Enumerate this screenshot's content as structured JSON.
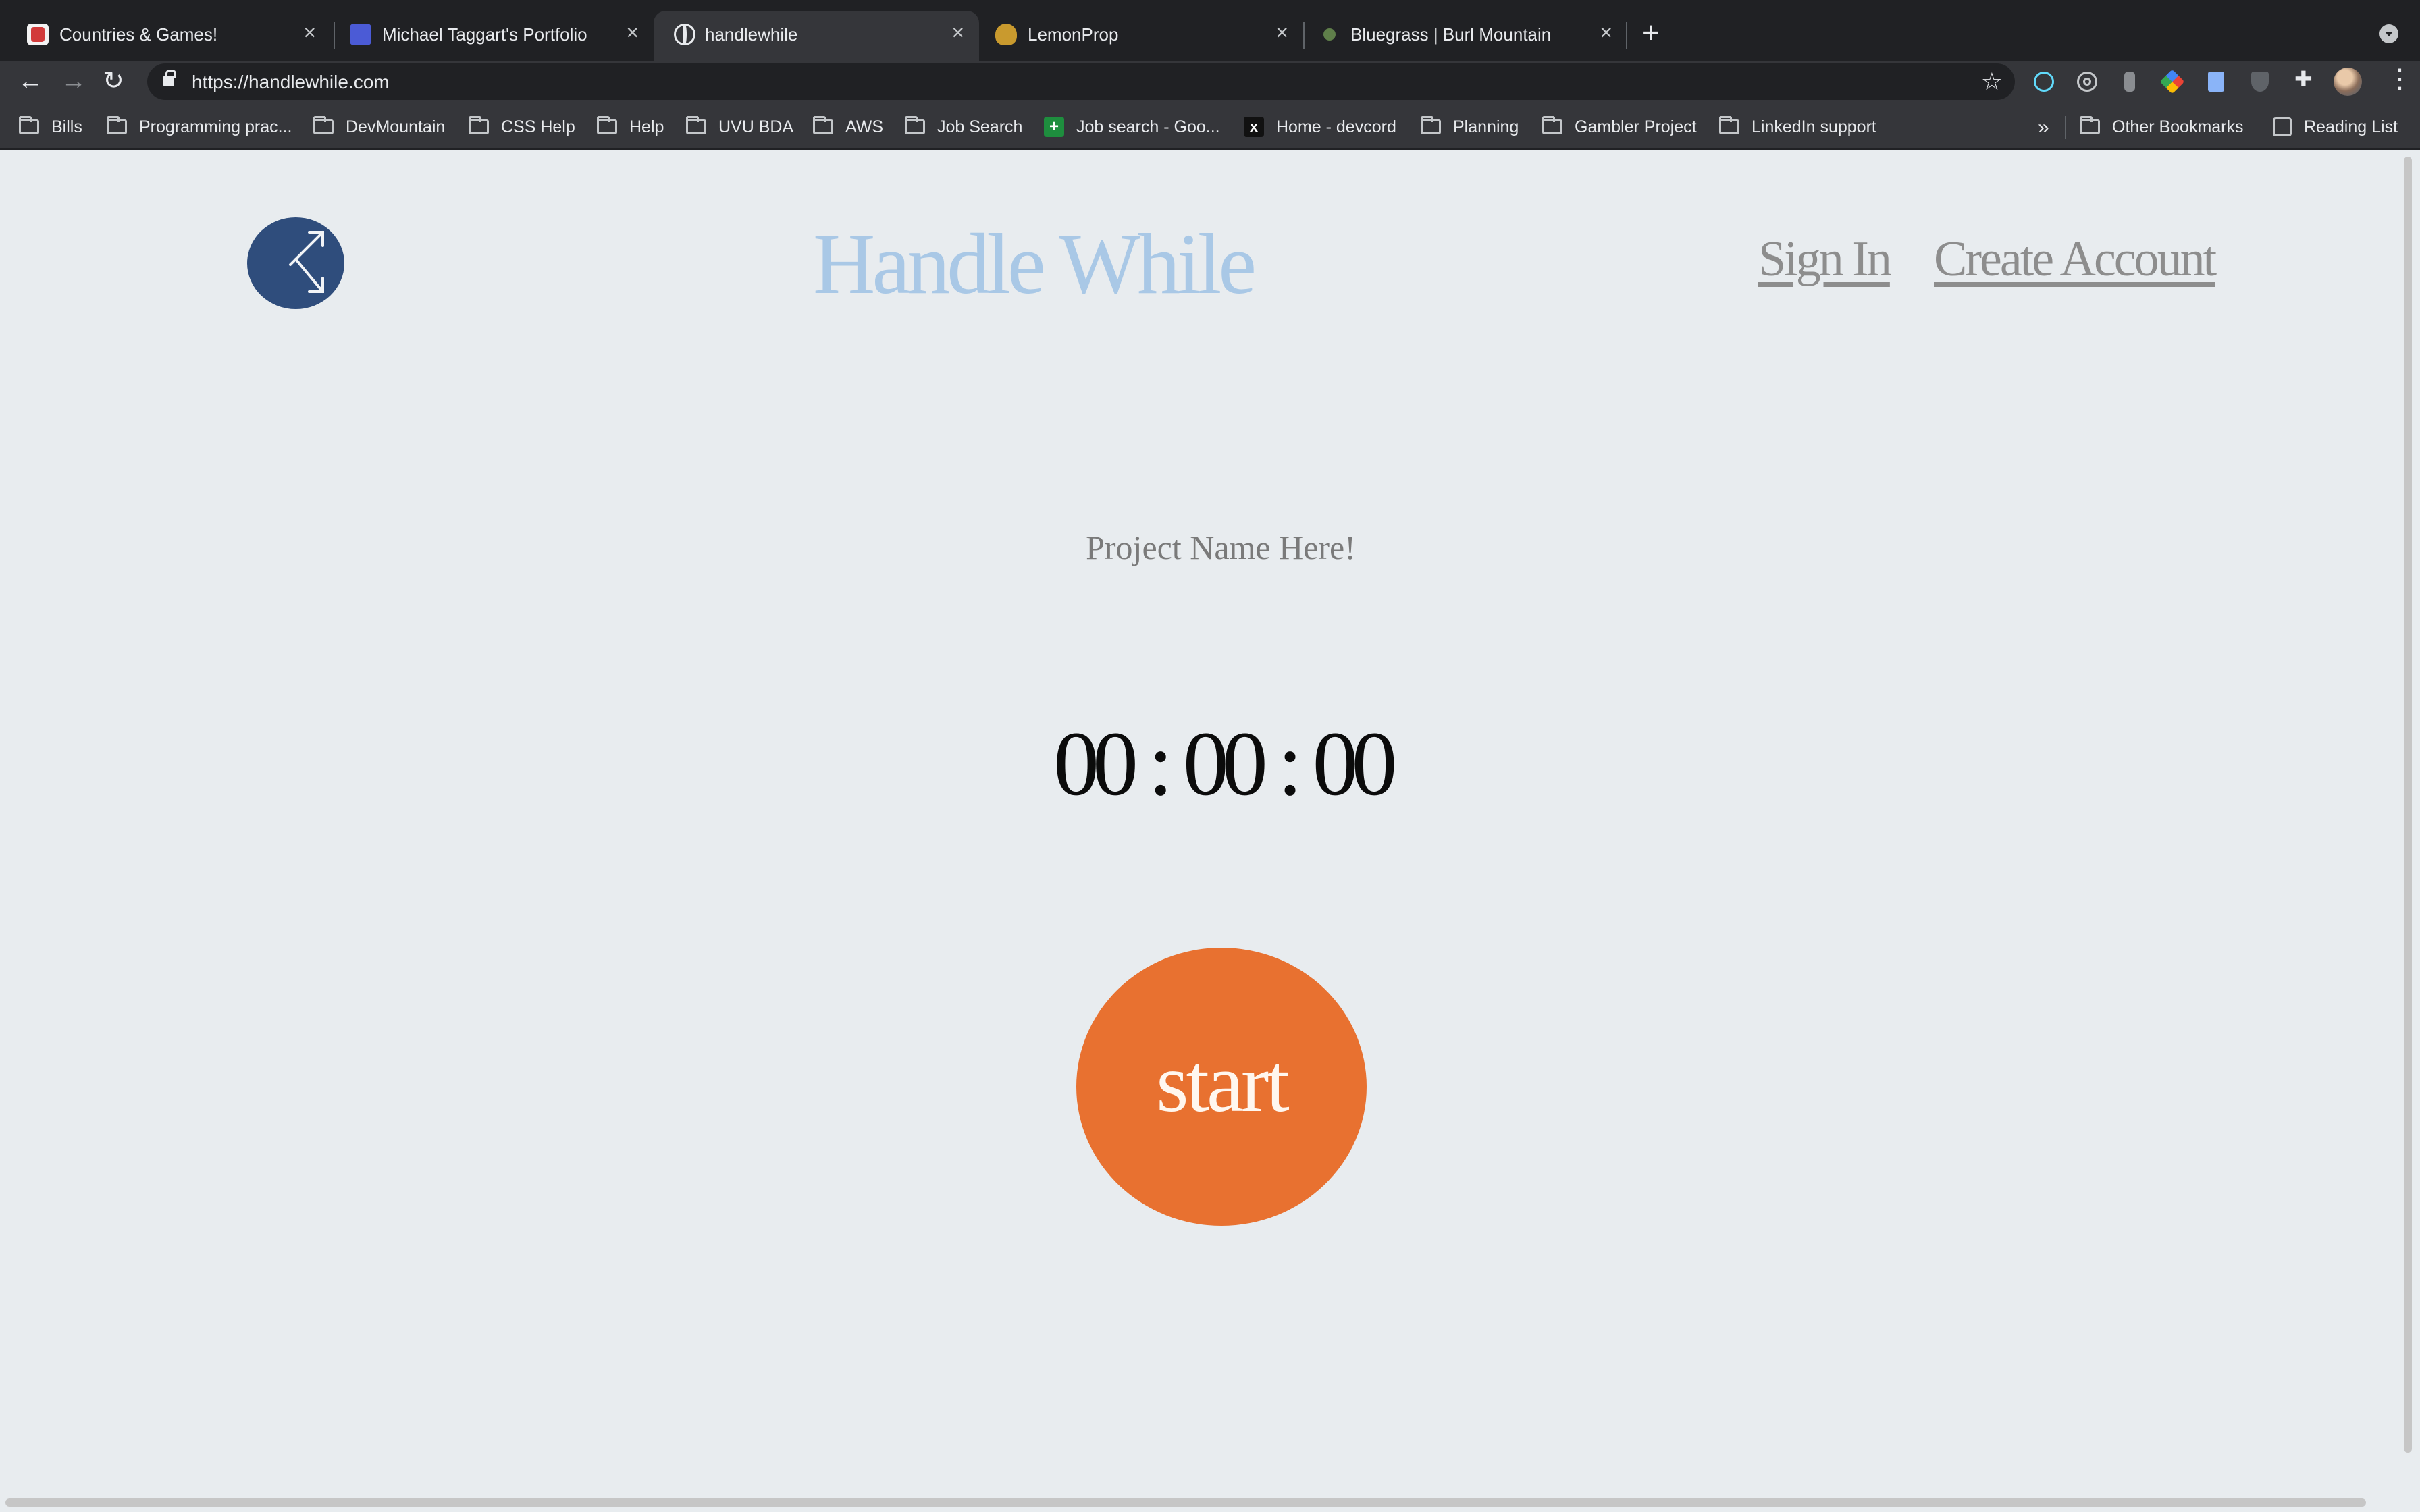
{
  "browser": {
    "tabs": [
      {
        "title": "Countries & Games!",
        "favicon": "countries-favicon",
        "color": "#d23b3b"
      },
      {
        "title": "Michael Taggart's Portfolio",
        "favicon": "portfolio-favicon",
        "color": "#4b5bd6"
      },
      {
        "title": "handlewhile",
        "favicon": "globe-icon",
        "color": "#e8eaed",
        "active": true
      },
      {
        "title": "LemonProp",
        "favicon": "lemonprop-favicon",
        "color": "#c99a2e"
      },
      {
        "title": "Bluegrass | Burl Mountain",
        "favicon": "burl-mountain-favicon",
        "color": "#5f7f4a"
      }
    ],
    "new_tab_label": "+",
    "url": "https://handlewhile.com",
    "bookmarks": [
      {
        "label": "Bills",
        "type": "folder"
      },
      {
        "label": "Programming prac...",
        "type": "folder"
      },
      {
        "label": "DevMountain",
        "type": "folder"
      },
      {
        "label": "CSS Help",
        "type": "folder"
      },
      {
        "label": "Help",
        "type": "folder"
      },
      {
        "label": "UVU BDA",
        "type": "folder"
      },
      {
        "label": "AWS",
        "type": "folder"
      },
      {
        "label": "Job Search",
        "type": "folder"
      },
      {
        "label": "Job search - Goo...",
        "type": "sheets"
      },
      {
        "label": "Home - devcord",
        "type": "devcord"
      },
      {
        "label": "Planning",
        "type": "folder"
      },
      {
        "label": "Gambler Project",
        "type": "folder"
      },
      {
        "label": "LinkedIn support",
        "type": "folder"
      }
    ],
    "bookmarks_overflow": "»",
    "other_bookmarks": "Other Bookmarks",
    "reading_list": "Reading List"
  },
  "page": {
    "logo_icon": "expand-arrows-icon",
    "title": "Handle While",
    "nav": {
      "sign_in": "Sign In",
      "create_account": "Create Account"
    },
    "project_name": "Project Name Here!",
    "timer": "00 : 00 : 00",
    "start_label": "start"
  },
  "colors": {
    "page_bg": "#e8ecef",
    "logo_bg": "#2f4d7c",
    "title": "#a9c8e6",
    "nav_link": "#8d8d8d",
    "start_button": "#e87130"
  }
}
